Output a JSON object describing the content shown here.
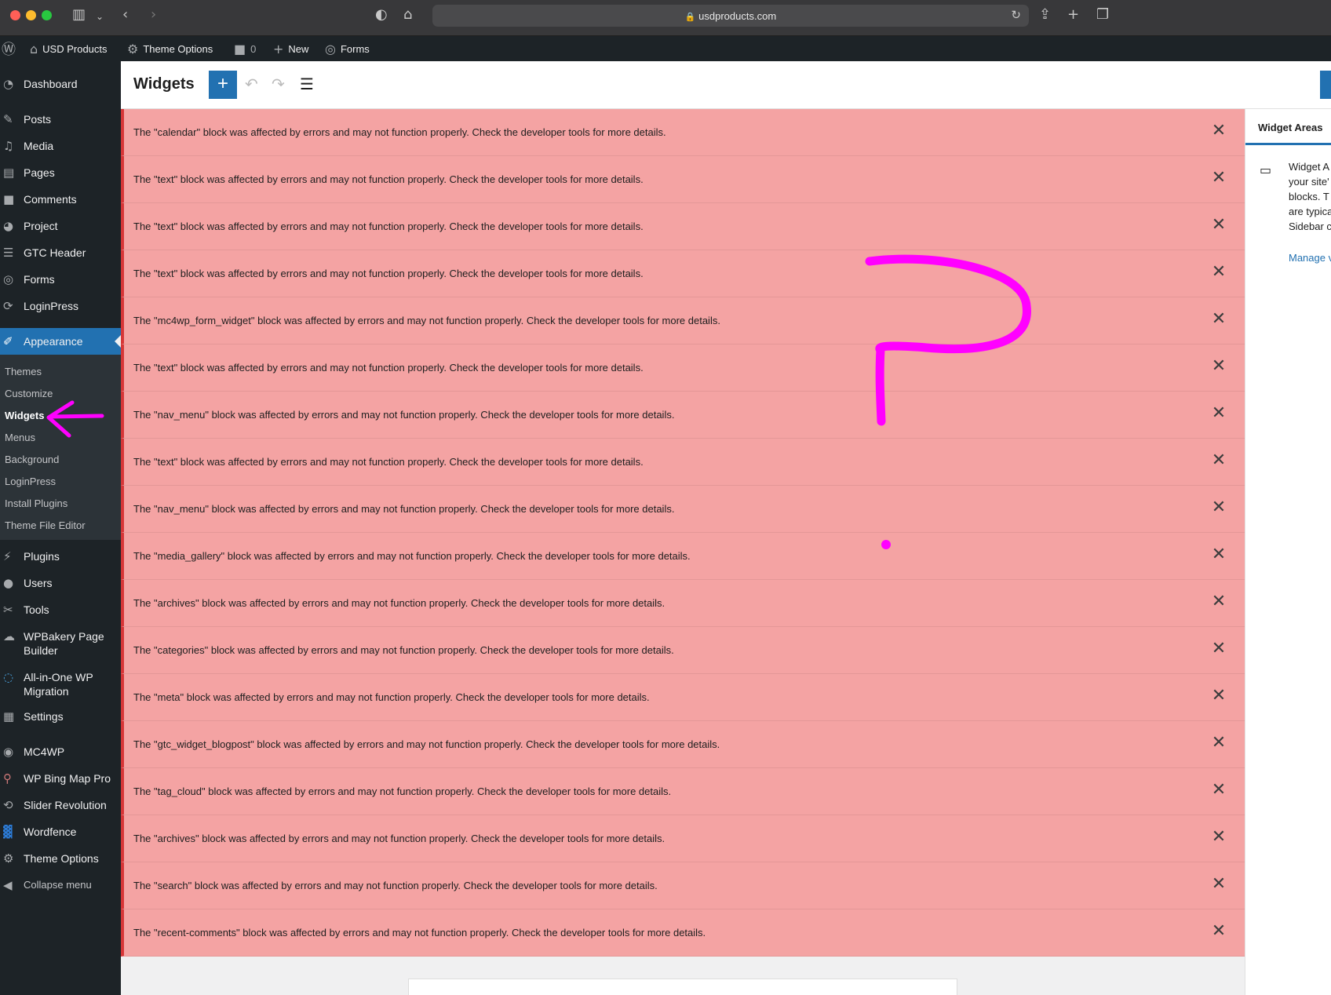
{
  "browser": {
    "url": "usdproducts.com"
  },
  "admin_bar": {
    "site_name": "USD Products",
    "theme_options": "Theme Options",
    "comments_count": "0",
    "new_label": "New",
    "forms_label": "Forms"
  },
  "sidebar": {
    "items": [
      {
        "label": "Dashboard",
        "icon": "dashboard-icon"
      },
      {
        "label": "Posts",
        "icon": "pin-icon"
      },
      {
        "label": "Media",
        "icon": "media-icon"
      },
      {
        "label": "Pages",
        "icon": "pages-icon"
      },
      {
        "label": "Comments",
        "icon": "comment-icon"
      },
      {
        "label": "Project",
        "icon": "project-icon"
      },
      {
        "label": "GTC Header",
        "icon": "menu-lines-icon"
      },
      {
        "label": "Forms",
        "icon": "forms-icon"
      },
      {
        "label": "LoginPress",
        "icon": "loginpress-icon"
      },
      {
        "label": "Appearance",
        "icon": "brush-icon"
      },
      {
        "label": "Plugins",
        "icon": "plug-icon"
      },
      {
        "label": "Users",
        "icon": "user-icon"
      },
      {
        "label": "Tools",
        "icon": "wrench-icon"
      },
      {
        "label": "WPBakery Page Builder",
        "icon": "cloud-icon"
      },
      {
        "label": "All-in-One WP Migration",
        "icon": "migration-icon"
      },
      {
        "label": "Settings",
        "icon": "settings-icon"
      },
      {
        "label": "MC4WP",
        "icon": "mc4wp-icon"
      },
      {
        "label": "WP Bing Map Pro",
        "icon": "map-pin-icon"
      },
      {
        "label": "Slider Revolution",
        "icon": "refresh-icon"
      },
      {
        "label": "Wordfence",
        "icon": "wordfence-icon"
      },
      {
        "label": "Theme Options",
        "icon": "gear-icon"
      },
      {
        "label": "Collapse menu",
        "icon": "collapse-icon"
      }
    ],
    "submenu": [
      "Themes",
      "Customize",
      "Widgets",
      "Menus",
      "Background",
      "LoginPress",
      "Install Plugins",
      "Theme File Editor"
    ]
  },
  "editor": {
    "title": "Widgets",
    "add_label": "+"
  },
  "notices": [
    "The \"calendar\" block was affected by errors and may not function properly. Check the developer tools for more details.",
    "The \"text\" block was affected by errors and may not function properly. Check the developer tools for more details.",
    "The \"text\" block was affected by errors and may not function properly. Check the developer tools for more details.",
    "The \"text\" block was affected by errors and may not function properly. Check the developer tools for more details.",
    "The \"mc4wp_form_widget\" block was affected by errors and may not function properly. Check the developer tools for more details.",
    "The \"text\" block was affected by errors and may not function properly. Check the developer tools for more details.",
    "The \"nav_menu\" block was affected by errors and may not function properly. Check the developer tools for more details.",
    "The \"text\" block was affected by errors and may not function properly. Check the developer tools for more details.",
    "The \"nav_menu\" block was affected by errors and may not function properly. Check the developer tools for more details.",
    "The \"media_gallery\" block was affected by errors and may not function properly. Check the developer tools for more details.",
    "The \"archives\" block was affected by errors and may not function properly. Check the developer tools for more details.",
    "The \"categories\" block was affected by errors and may not function properly. Check the developer tools for more details.",
    "The \"meta\" block was affected by errors and may not function properly. Check the developer tools for more details.",
    "The \"gtc_widget_blogpost\" block was affected by errors and may not function properly. Check the developer tools for more details.",
    "The \"tag_cloud\" block was affected by errors and may not function properly. Check the developer tools for more details.",
    "The \"archives\" block was affected by errors and may not function properly. Check the developer tools for more details.",
    "The \"search\" block was affected by errors and may not function properly. Check the developer tools for more details.",
    "The \"recent-comments\" block was affected by errors and may not function properly. Check the developer tools for more details."
  ],
  "panel": {
    "tab": "Widget Areas",
    "desc_lines": [
      "Widget A",
      "your site'",
      "blocks. T",
      "are typica",
      "Sidebar c"
    ],
    "manage_link": "Manage v"
  },
  "colors": {
    "notice_bg": "#f4a3a3",
    "notice_border": "#d63638",
    "accent": "#2271b1",
    "annotation": "#ff00ff"
  }
}
